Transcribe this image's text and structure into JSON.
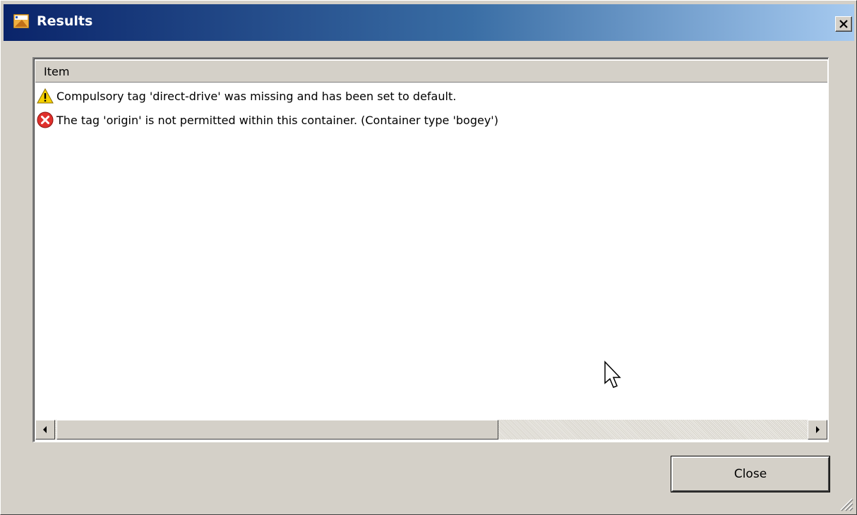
{
  "window": {
    "title": "Results",
    "app_icon": "app-icon",
    "close_icon": "close-icon"
  },
  "list": {
    "columns": [
      "Item"
    ],
    "rows": [
      {
        "severity": "warning",
        "icon": "warning-icon",
        "text": "Compulsory tag 'direct-drive' was missing and has been set to default."
      },
      {
        "severity": "error",
        "icon": "error-icon",
        "text": "The tag 'origin' is not permitted within this container. (Container type 'bogey')"
      }
    ],
    "scrollbar": {
      "horizontal_position": 0.0,
      "left_arrow_icon": "arrow-left-icon",
      "right_arrow_icon": "arrow-right-icon"
    }
  },
  "footer": {
    "close_label": "Close"
  },
  "colors": {
    "title_start": "#0a246a",
    "title_end": "#a6caf0",
    "face": "#d4d0c8",
    "warning": "#f5d000",
    "error": "#e0302c"
  }
}
